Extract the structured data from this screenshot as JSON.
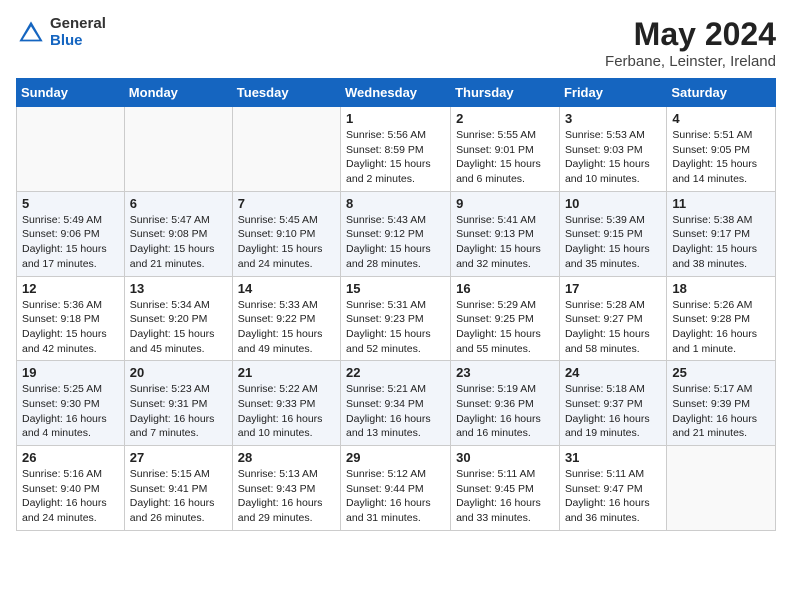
{
  "header": {
    "logo_general": "General",
    "logo_blue": "Blue",
    "title": "May 2024",
    "subtitle": "Ferbane, Leinster, Ireland"
  },
  "days_of_week": [
    "Sunday",
    "Monday",
    "Tuesday",
    "Wednesday",
    "Thursday",
    "Friday",
    "Saturday"
  ],
  "weeks": [
    [
      {
        "num": "",
        "info": ""
      },
      {
        "num": "",
        "info": ""
      },
      {
        "num": "",
        "info": ""
      },
      {
        "num": "1",
        "info": "Sunrise: 5:56 AM\nSunset: 8:59 PM\nDaylight: 15 hours\nand 2 minutes."
      },
      {
        "num": "2",
        "info": "Sunrise: 5:55 AM\nSunset: 9:01 PM\nDaylight: 15 hours\nand 6 minutes."
      },
      {
        "num": "3",
        "info": "Sunrise: 5:53 AM\nSunset: 9:03 PM\nDaylight: 15 hours\nand 10 minutes."
      },
      {
        "num": "4",
        "info": "Sunrise: 5:51 AM\nSunset: 9:05 PM\nDaylight: 15 hours\nand 14 minutes."
      }
    ],
    [
      {
        "num": "5",
        "info": "Sunrise: 5:49 AM\nSunset: 9:06 PM\nDaylight: 15 hours\nand 17 minutes."
      },
      {
        "num": "6",
        "info": "Sunrise: 5:47 AM\nSunset: 9:08 PM\nDaylight: 15 hours\nand 21 minutes."
      },
      {
        "num": "7",
        "info": "Sunrise: 5:45 AM\nSunset: 9:10 PM\nDaylight: 15 hours\nand 24 minutes."
      },
      {
        "num": "8",
        "info": "Sunrise: 5:43 AM\nSunset: 9:12 PM\nDaylight: 15 hours\nand 28 minutes."
      },
      {
        "num": "9",
        "info": "Sunrise: 5:41 AM\nSunset: 9:13 PM\nDaylight: 15 hours\nand 32 minutes."
      },
      {
        "num": "10",
        "info": "Sunrise: 5:39 AM\nSunset: 9:15 PM\nDaylight: 15 hours\nand 35 minutes."
      },
      {
        "num": "11",
        "info": "Sunrise: 5:38 AM\nSunset: 9:17 PM\nDaylight: 15 hours\nand 38 minutes."
      }
    ],
    [
      {
        "num": "12",
        "info": "Sunrise: 5:36 AM\nSunset: 9:18 PM\nDaylight: 15 hours\nand 42 minutes."
      },
      {
        "num": "13",
        "info": "Sunrise: 5:34 AM\nSunset: 9:20 PM\nDaylight: 15 hours\nand 45 minutes."
      },
      {
        "num": "14",
        "info": "Sunrise: 5:33 AM\nSunset: 9:22 PM\nDaylight: 15 hours\nand 49 minutes."
      },
      {
        "num": "15",
        "info": "Sunrise: 5:31 AM\nSunset: 9:23 PM\nDaylight: 15 hours\nand 52 minutes."
      },
      {
        "num": "16",
        "info": "Sunrise: 5:29 AM\nSunset: 9:25 PM\nDaylight: 15 hours\nand 55 minutes."
      },
      {
        "num": "17",
        "info": "Sunrise: 5:28 AM\nSunset: 9:27 PM\nDaylight: 15 hours\nand 58 minutes."
      },
      {
        "num": "18",
        "info": "Sunrise: 5:26 AM\nSunset: 9:28 PM\nDaylight: 16 hours\nand 1 minute."
      }
    ],
    [
      {
        "num": "19",
        "info": "Sunrise: 5:25 AM\nSunset: 9:30 PM\nDaylight: 16 hours\nand 4 minutes."
      },
      {
        "num": "20",
        "info": "Sunrise: 5:23 AM\nSunset: 9:31 PM\nDaylight: 16 hours\nand 7 minutes."
      },
      {
        "num": "21",
        "info": "Sunrise: 5:22 AM\nSunset: 9:33 PM\nDaylight: 16 hours\nand 10 minutes."
      },
      {
        "num": "22",
        "info": "Sunrise: 5:21 AM\nSunset: 9:34 PM\nDaylight: 16 hours\nand 13 minutes."
      },
      {
        "num": "23",
        "info": "Sunrise: 5:19 AM\nSunset: 9:36 PM\nDaylight: 16 hours\nand 16 minutes."
      },
      {
        "num": "24",
        "info": "Sunrise: 5:18 AM\nSunset: 9:37 PM\nDaylight: 16 hours\nand 19 minutes."
      },
      {
        "num": "25",
        "info": "Sunrise: 5:17 AM\nSunset: 9:39 PM\nDaylight: 16 hours\nand 21 minutes."
      }
    ],
    [
      {
        "num": "26",
        "info": "Sunrise: 5:16 AM\nSunset: 9:40 PM\nDaylight: 16 hours\nand 24 minutes."
      },
      {
        "num": "27",
        "info": "Sunrise: 5:15 AM\nSunset: 9:41 PM\nDaylight: 16 hours\nand 26 minutes."
      },
      {
        "num": "28",
        "info": "Sunrise: 5:13 AM\nSunset: 9:43 PM\nDaylight: 16 hours\nand 29 minutes."
      },
      {
        "num": "29",
        "info": "Sunrise: 5:12 AM\nSunset: 9:44 PM\nDaylight: 16 hours\nand 31 minutes."
      },
      {
        "num": "30",
        "info": "Sunrise: 5:11 AM\nSunset: 9:45 PM\nDaylight: 16 hours\nand 33 minutes."
      },
      {
        "num": "31",
        "info": "Sunrise: 5:11 AM\nSunset: 9:47 PM\nDaylight: 16 hours\nand 36 minutes."
      },
      {
        "num": "",
        "info": ""
      }
    ]
  ]
}
